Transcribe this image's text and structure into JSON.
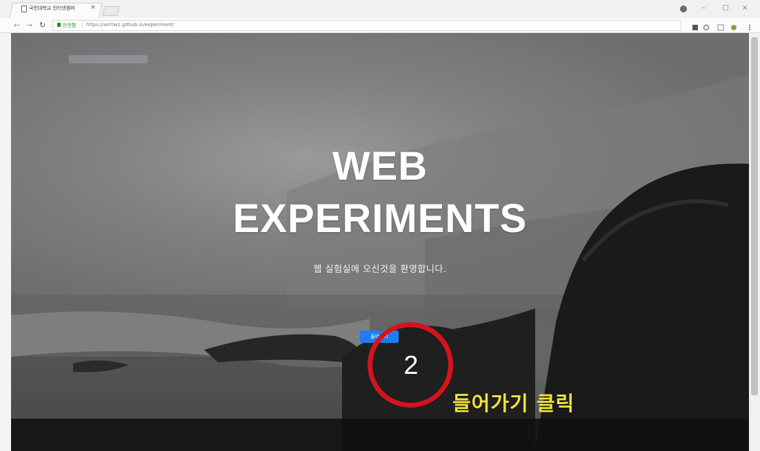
{
  "browser": {
    "tab_title": "국민대학교 인터넷캠퍼",
    "tab_close": "×",
    "secure_label": "안전함",
    "url": "https://anrtw1.github.io/experiment/"
  },
  "page": {
    "title_line1": "WEB",
    "title_line2": "EXPERIMENTS",
    "subtitle": "웹 실험실에 오신것을 환영합니다.",
    "enter_button": "들어가기"
  },
  "annotation": {
    "step_number": "2",
    "caption": "들어가기 클릭",
    "circle_color": "#d4141c",
    "caption_color": "#f3e23a"
  },
  "colors": {
    "button_blue": "#1e7df0"
  }
}
